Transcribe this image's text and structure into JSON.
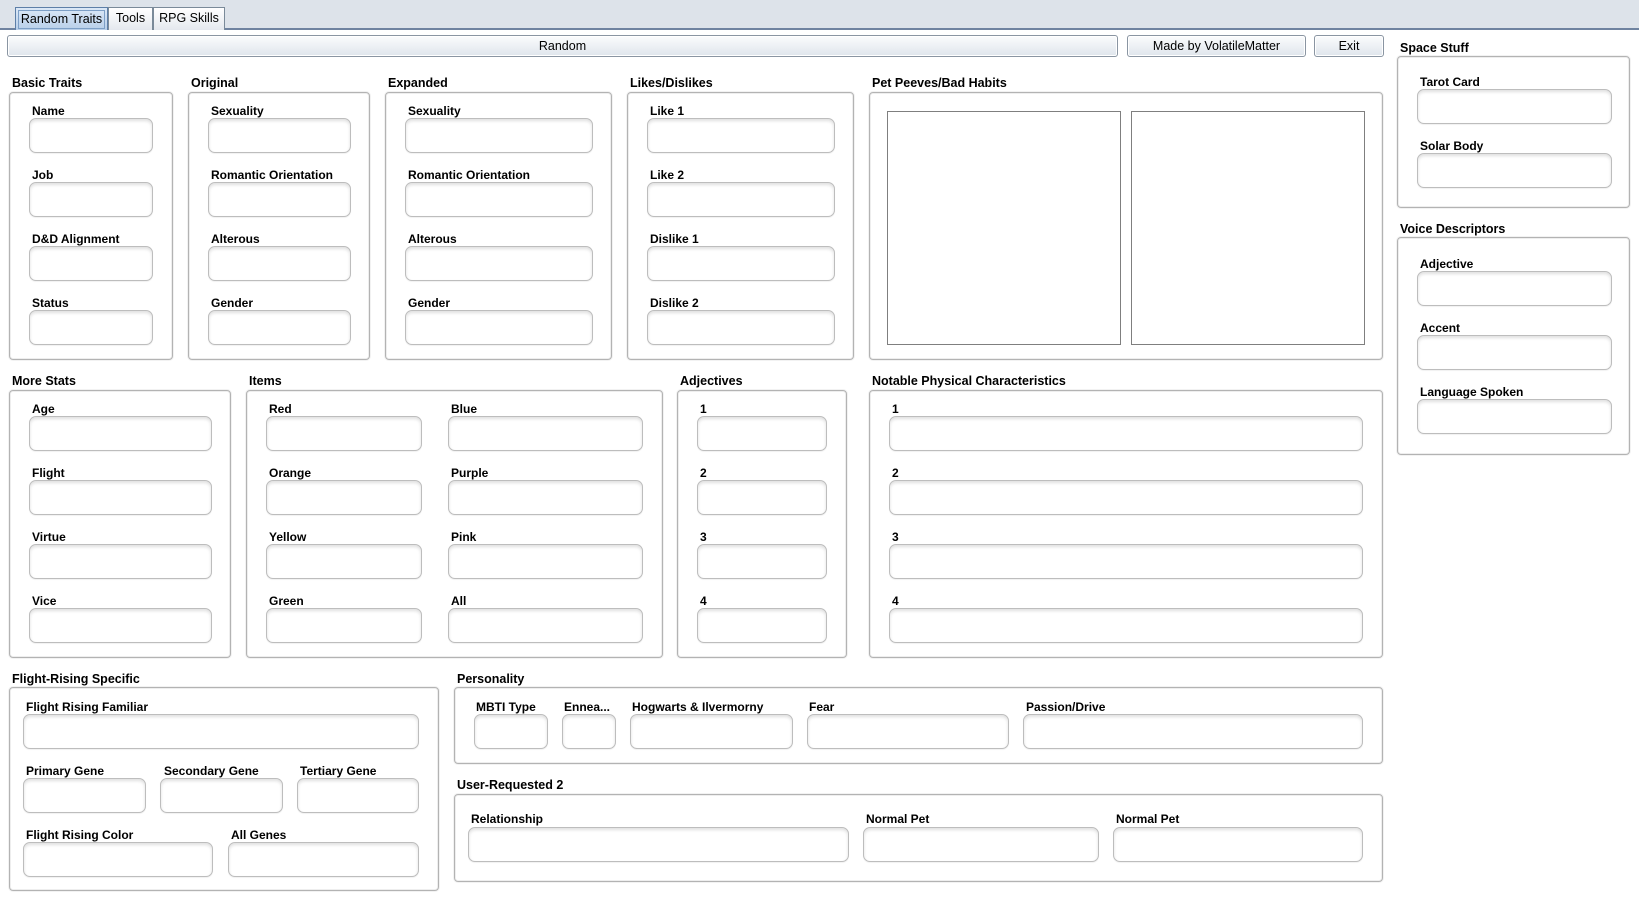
{
  "tabs": [
    {
      "label": "Random Traits"
    },
    {
      "label": "Tools"
    },
    {
      "label": "RPG Skills"
    }
  ],
  "toolbar": {
    "random_label": "Random",
    "credit_label": "Made by VolatileMatter",
    "exit_label": "Exit"
  },
  "basic_traits": {
    "title": "Basic Traits",
    "fields": [
      {
        "label": "Name",
        "value": ""
      },
      {
        "label": "Job",
        "value": ""
      },
      {
        "label": "D&D Alignment",
        "value": ""
      },
      {
        "label": "Status",
        "value": ""
      }
    ]
  },
  "original": {
    "title": "Original",
    "fields": [
      {
        "label": "Sexuality",
        "value": ""
      },
      {
        "label": "Romantic Orientation",
        "value": ""
      },
      {
        "label": "Alterous",
        "value": ""
      },
      {
        "label": "Gender",
        "value": ""
      }
    ]
  },
  "expanded": {
    "title": "Expanded",
    "fields": [
      {
        "label": "Sexuality",
        "value": ""
      },
      {
        "label": "Romantic Orientation",
        "value": ""
      },
      {
        "label": "Alterous",
        "value": ""
      },
      {
        "label": "Gender",
        "value": ""
      }
    ]
  },
  "likes": {
    "title": "Likes/Dislikes",
    "fields": [
      {
        "label": "Like 1",
        "value": ""
      },
      {
        "label": "Like 2",
        "value": ""
      },
      {
        "label": "Dislike 1",
        "value": ""
      },
      {
        "label": "Dislike 2",
        "value": ""
      }
    ]
  },
  "pet_peeves": {
    "title": "Pet Peeves/Bad Habits",
    "left_text": "",
    "right_text": ""
  },
  "space_stuff": {
    "title": "Space Stuff",
    "fields": [
      {
        "label": "Tarot Card",
        "value": ""
      },
      {
        "label": "Solar Body",
        "value": ""
      }
    ]
  },
  "voice": {
    "title": "Voice Descriptors",
    "fields": [
      {
        "label": "Adjective",
        "value": ""
      },
      {
        "label": "Accent",
        "value": ""
      },
      {
        "label": "Language Spoken",
        "value": ""
      }
    ]
  },
  "more_stats": {
    "title": "More Stats",
    "fields": [
      {
        "label": "Age",
        "value": ""
      },
      {
        "label": "Flight",
        "value": ""
      },
      {
        "label": "Virtue",
        "value": ""
      },
      {
        "label": "Vice",
        "value": ""
      }
    ]
  },
  "items": {
    "title": "Items",
    "fields": [
      {
        "label": "Red",
        "value": ""
      },
      {
        "label": "Blue",
        "value": ""
      },
      {
        "label": "Orange",
        "value": ""
      },
      {
        "label": "Purple",
        "value": ""
      },
      {
        "label": "Yellow",
        "value": ""
      },
      {
        "label": "Pink",
        "value": ""
      },
      {
        "label": "Green",
        "value": ""
      },
      {
        "label": "All",
        "value": ""
      }
    ]
  },
  "adjectives": {
    "title": "Adjectives",
    "fields": [
      {
        "label": "1",
        "value": ""
      },
      {
        "label": "2",
        "value": ""
      },
      {
        "label": "3",
        "value": ""
      },
      {
        "label": "4",
        "value": ""
      }
    ]
  },
  "physical": {
    "title": "Notable Physical Characteristics",
    "fields": [
      {
        "label": "1",
        "value": ""
      },
      {
        "label": "2",
        "value": ""
      },
      {
        "label": "3",
        "value": ""
      },
      {
        "label": "4",
        "value": ""
      }
    ]
  },
  "flight_rising": {
    "title": "Flight-Rising Specific",
    "fields": [
      {
        "label": "Flight Rising Familiar",
        "value": ""
      },
      {
        "label": "Primary Gene",
        "value": ""
      },
      {
        "label": "Secondary Gene",
        "value": ""
      },
      {
        "label": "Tertiary Gene",
        "value": ""
      },
      {
        "label": "Flight Rising Color",
        "value": ""
      },
      {
        "label": "All Genes",
        "value": ""
      }
    ]
  },
  "personality": {
    "title": "Personality",
    "fields": [
      {
        "label": "MBTI Type",
        "value": ""
      },
      {
        "label": "Ennea...",
        "value": ""
      },
      {
        "label": "Hogwarts & Ilvermorny",
        "value": ""
      },
      {
        "label": "Fear",
        "value": ""
      },
      {
        "label": "Passion/Drive",
        "value": ""
      }
    ]
  },
  "user_requested": {
    "title": "User-Requested 2",
    "fields": [
      {
        "label": "Relationship",
        "value": ""
      },
      {
        "label": "Normal Pet",
        "value": ""
      },
      {
        "label": "Normal Pet",
        "value": ""
      }
    ]
  }
}
